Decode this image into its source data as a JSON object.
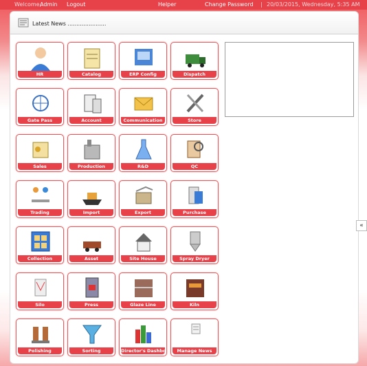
{
  "topbar": {
    "welcome_label": "Welcome,",
    "user": "Admin",
    "logout": "Logout",
    "helper": "Helper",
    "change_password": "Change Password",
    "separator": "|",
    "datetime": "20/03/2015, Wednesday, 5:35 AM"
  },
  "news": {
    "title": "Latest News ......................"
  },
  "tiles": [
    {
      "label": "HR",
      "icon": "user-icon"
    },
    {
      "label": "Catalog",
      "icon": "catalog-icon"
    },
    {
      "label": "ERP Config",
      "icon": "erp-config-icon"
    },
    {
      "label": "Dispatch",
      "icon": "truck-icon"
    },
    {
      "label": "Gate Pass",
      "icon": "network-icon"
    },
    {
      "label": "Account",
      "icon": "account-icon"
    },
    {
      "label": "Communication",
      "icon": "mail-icon"
    },
    {
      "label": "Store",
      "icon": "tools-icon"
    },
    {
      "label": "Sales",
      "icon": "sales-icon"
    },
    {
      "label": "Production",
      "icon": "production-icon"
    },
    {
      "label": "R&D",
      "icon": "flask-icon"
    },
    {
      "label": "QC",
      "icon": "qc-icon"
    },
    {
      "label": "Trading",
      "icon": "trading-icon"
    },
    {
      "label": "Import",
      "icon": "ship-icon"
    },
    {
      "label": "Export",
      "icon": "export-icon"
    },
    {
      "label": "Purchase",
      "icon": "purchase-icon"
    },
    {
      "label": "Collection",
      "icon": "collection-icon"
    },
    {
      "label": "Asset",
      "icon": "asset-icon"
    },
    {
      "label": "Site House",
      "icon": "house-icon"
    },
    {
      "label": "Spray Dryer",
      "icon": "dryer-icon"
    },
    {
      "label": "Silo",
      "icon": "silo-icon"
    },
    {
      "label": "Press",
      "icon": "press-icon"
    },
    {
      "label": "Glaze Line",
      "icon": "glaze-line-icon"
    },
    {
      "label": "Kiln",
      "icon": "kiln-icon"
    },
    {
      "label": "Polishing",
      "icon": "polishing-icon"
    },
    {
      "label": "Sorting",
      "icon": "sorting-icon"
    },
    {
      "label": "Director's Dashboard",
      "icon": "dashboard-icon"
    },
    {
      "label": "Manage News",
      "icon": "news-icon"
    }
  ],
  "scroll_top": "«",
  "colors": {
    "accent": "#e7424a",
    "tile_border": "#e25a5e"
  }
}
